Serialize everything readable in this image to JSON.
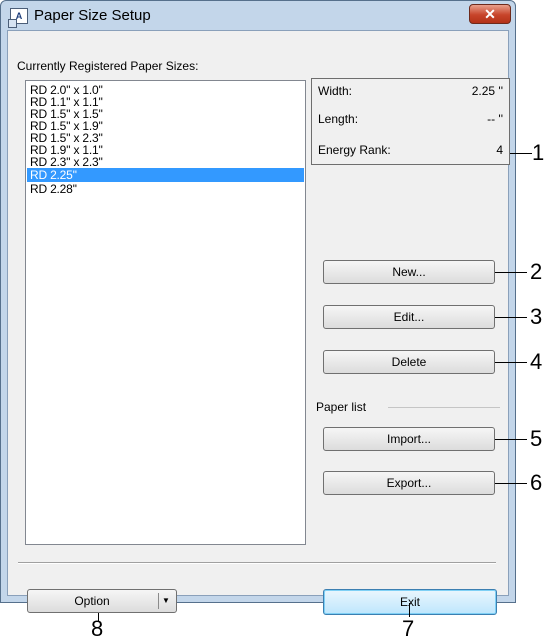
{
  "window": {
    "title": "Paper Size Setup",
    "close_label": "✕"
  },
  "list": {
    "label": "Currently Registered Paper Sizes:",
    "items": [
      "RD 2.0'' x 1.0''",
      "RD 1.1'' x 1.1''",
      "RD 1.5'' x 1.5''",
      "RD 1.5'' x 1.9''",
      "RD 1.5'' x 2.3''",
      "RD 1.9'' x 1.1''",
      "RD 2.3'' x 2.3''",
      "RD 2.25''",
      "RD 2.28''"
    ],
    "selected_index": 7
  },
  "info": {
    "width_label": "Width:",
    "width_value": "2.25 ''",
    "length_label": "Length:",
    "length_value": "-- ''",
    "energy_label": "Energy Rank:",
    "energy_value": "4"
  },
  "buttons": {
    "new": "New...",
    "edit": "Edit...",
    "delete": "Delete",
    "import": "Import...",
    "export": "Export...",
    "option": "Option",
    "exit": "Exit"
  },
  "paper_list_label": "Paper list",
  "callouts": [
    "1",
    "2",
    "3",
    "4",
    "5",
    "6",
    "7",
    "8"
  ],
  "colors": {
    "selection": "#3399ff",
    "title_bar": "#c3d6ea",
    "close_button": "#c7442a"
  }
}
